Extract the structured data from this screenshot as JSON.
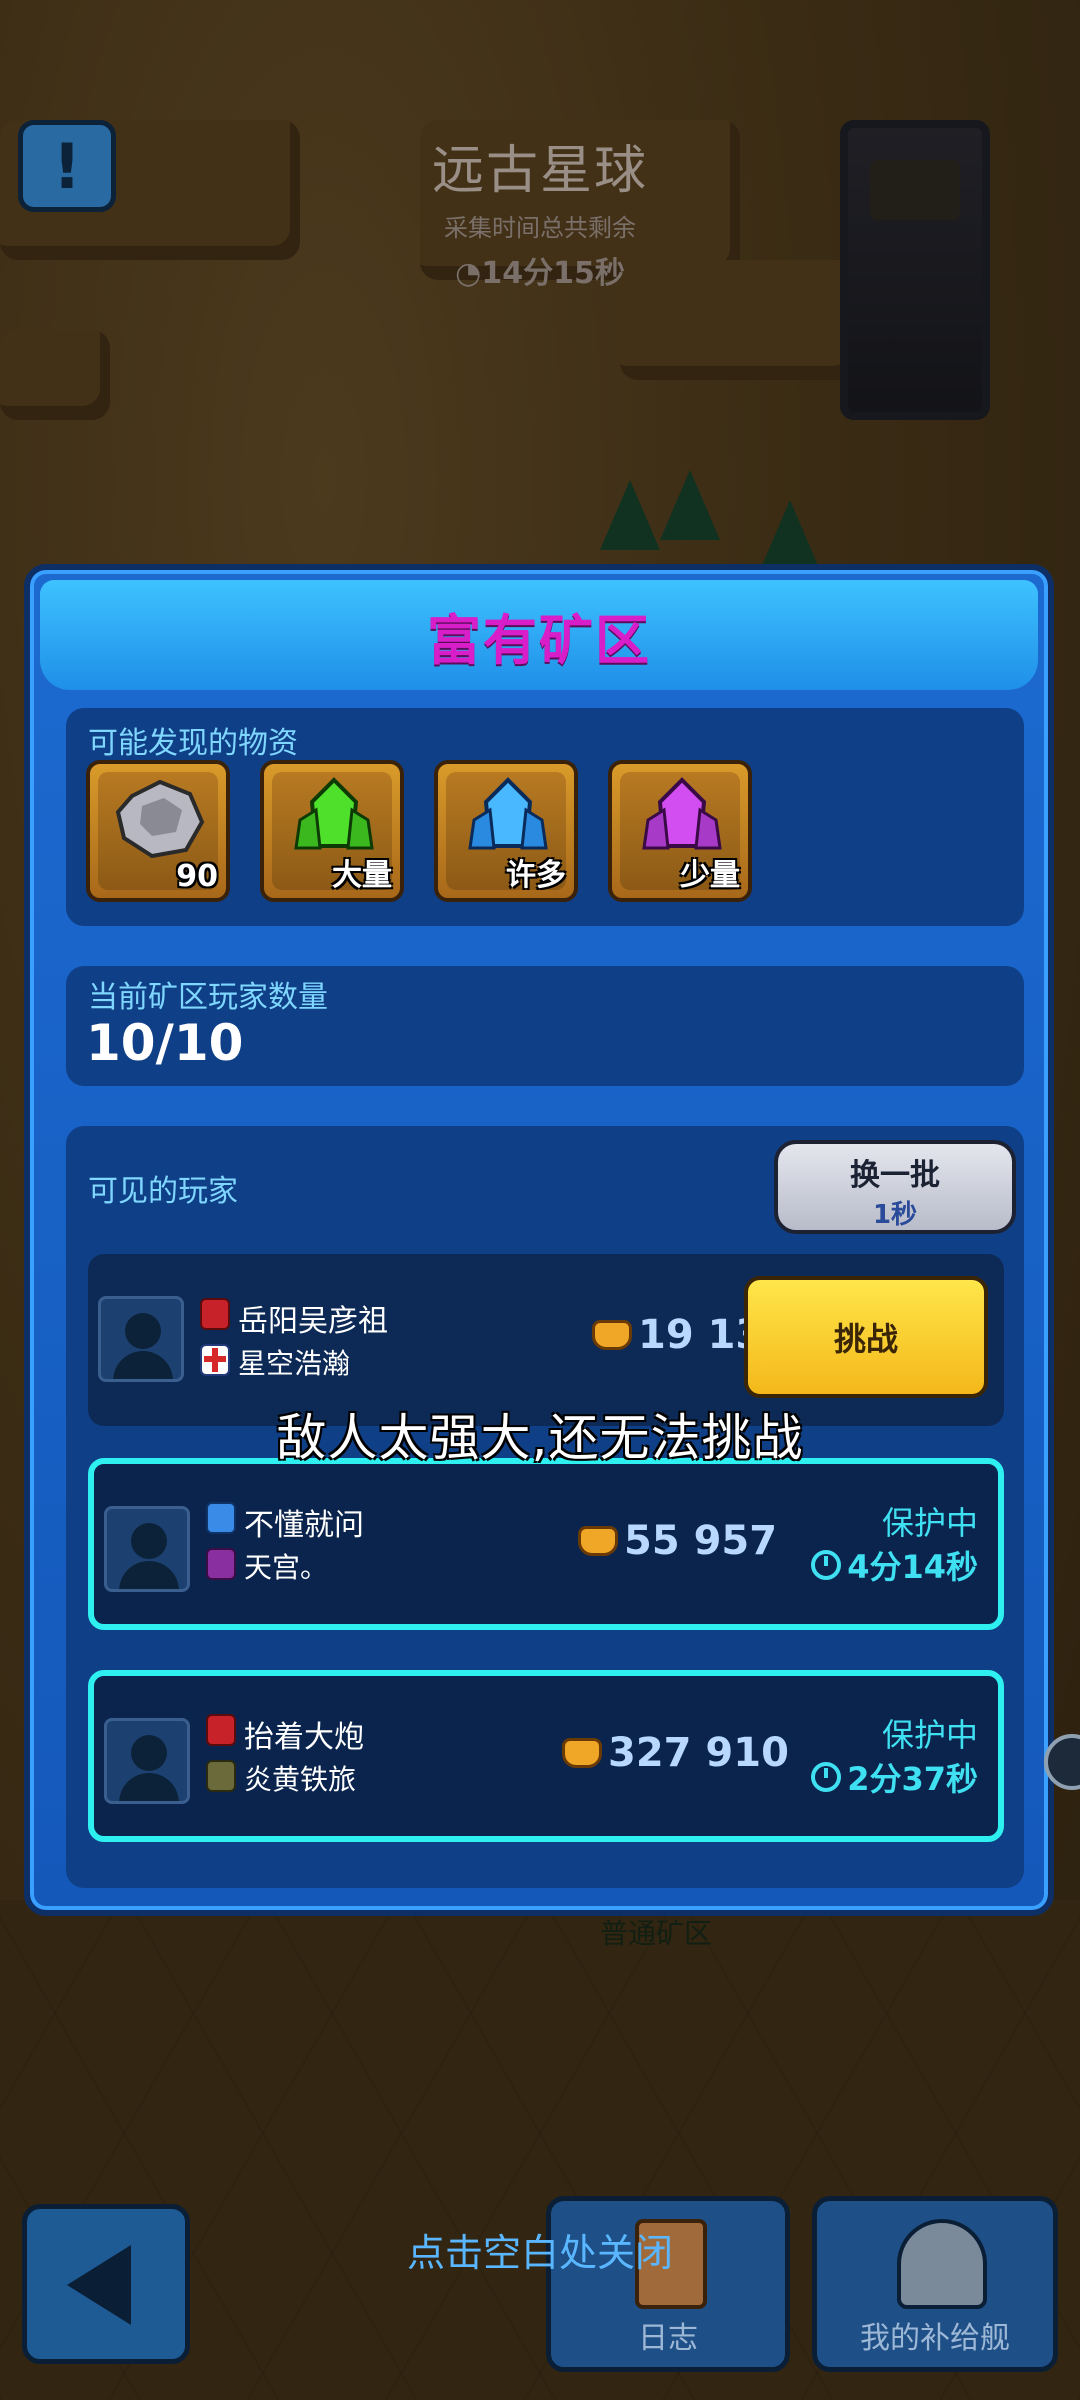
{
  "top": {
    "planet_title": "远古星球",
    "subtitle": "采集时间总共剩余",
    "timer": "14分15秒"
  },
  "dialog": {
    "title": "富有矿区",
    "resources": {
      "label": "可能发现的物资",
      "items": [
        {
          "icon": "ore-rock-icon",
          "qty": "90",
          "color": "#9a9aa4"
        },
        {
          "icon": "green-crystal-icon",
          "qty": "大量",
          "color": "#3ccf2a"
        },
        {
          "icon": "blue-crystal-icon",
          "qty": "许多",
          "color": "#3aa8ff"
        },
        {
          "icon": "purple-crystal-icon",
          "qty": "少量",
          "color": "#c43ae8"
        }
      ]
    },
    "player_count": {
      "label": "当前矿区玩家数量",
      "value": "10/10"
    },
    "players": {
      "label": "可见的玩家",
      "refresh_label": "换一批",
      "refresh_timer": "1秒",
      "list": [
        {
          "name": "岳阳吴彦祖",
          "guild": "星空浩瀚",
          "power": "19 134",
          "action": "挑战"
        },
        {
          "name": "不懂就问",
          "guild": "天宫。",
          "power": "55 957",
          "status": "保护中",
          "timer": "4分14秒"
        },
        {
          "name": "抬着大炮",
          "guild": "炎黄铁旅",
          "power": "327 910",
          "status": "保护中",
          "timer": "2分37秒"
        }
      ]
    }
  },
  "toast": "敌人太强大,还无法挑战",
  "bottom": {
    "close_hint": "点击空白处关闭",
    "log_label": "日志",
    "ship_label": "我的补给舰",
    "mine_label": "普通矿区"
  }
}
